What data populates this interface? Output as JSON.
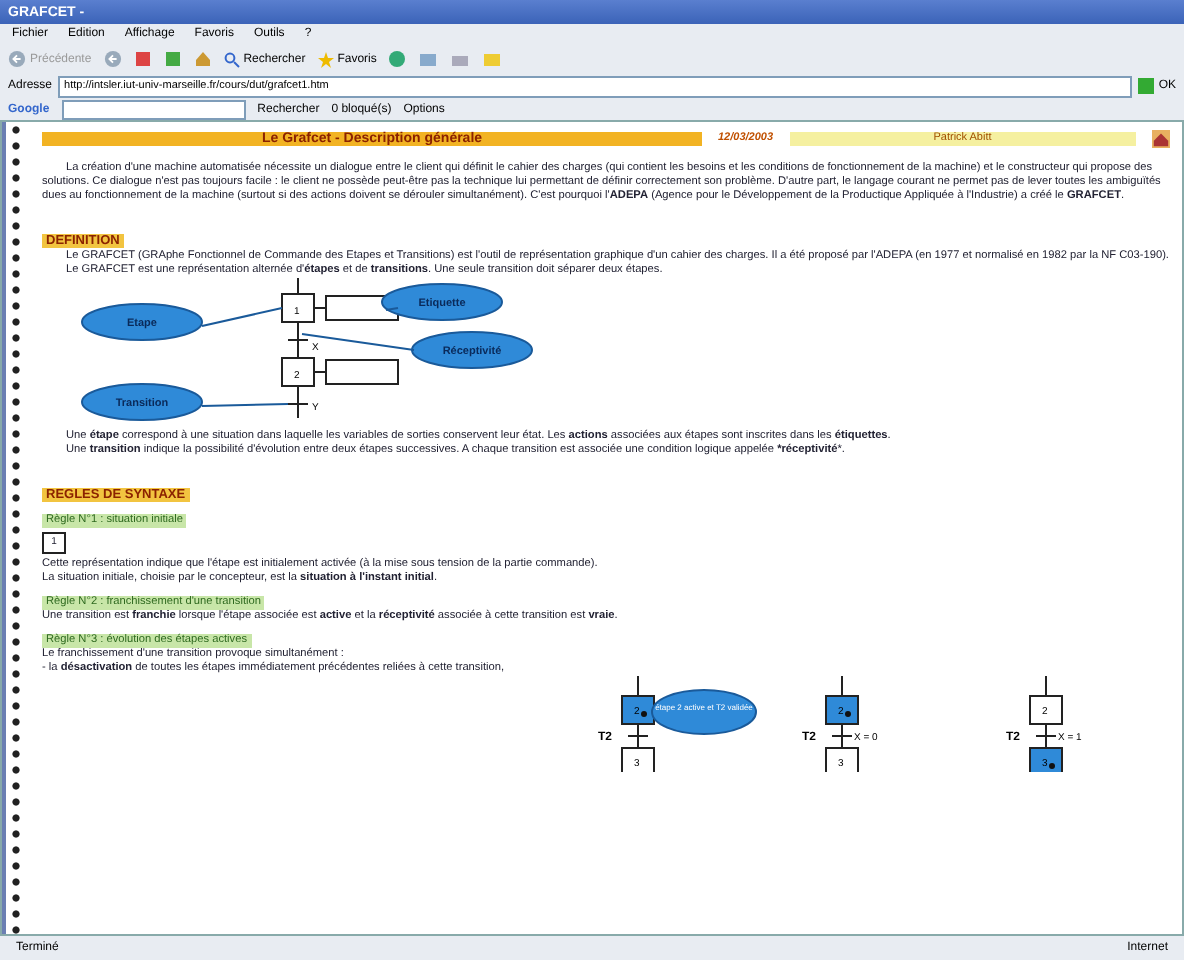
{
  "window": {
    "title": "GRAFCET -"
  },
  "menu": [
    "Fichier",
    "Edition",
    "Affichage",
    "Favoris",
    "Outils",
    "?"
  ],
  "toolbar": {
    "back": "Précédente",
    "search": "Rechercher",
    "favorites": "Favoris"
  },
  "address": {
    "label": "Adresse",
    "value": "http://intsler.iut-univ-marseille.fr/cours/dut/grafcet1.htm",
    "go": "OK"
  },
  "google_bar": {
    "logo": "Google",
    "search": "Rechercher",
    "blocked": "0 bloqué(s)",
    "options": "Options"
  },
  "page": {
    "title": "Le Grafcet - Description générale",
    "date": "12/03/2003",
    "author": "Patrick Abitt",
    "intro": "La création d'une machine automatisée nécessite un dialogue entre le client qui définit le cahier des charges (qui contient les besoins et les conditions de fonctionnement de la machine) et le constructeur qui propose des solutions. Ce dialogue n'est pas toujours facile : le client ne possède peut-être pas la technique lui permettant de définir correctement son problème. D'autre part, le langage courant ne permet pas de lever toutes les ambiguïtés dues au fonctionnement de la machine (surtout si des actions doivent se dérouler simultanément). C'est pourquoi l'**ADEPA** (Agence pour le Développement de la Productique Appliquée à l'Industrie) a créé le **GRAFCET**.",
    "definition": {
      "heading": "DEFINITION",
      "paragraphs": [
        "Le GRAFCET (GRAphe Fonctionnel de Commande des Etapes et Transitions) est l'outil de représentation graphique d'un cahier des charges. Il a été proposé par l'ADEPA (en 1977 et normalisé en 1982 par la NF C03-190).",
        "Le GRAFCET est une représentation alternée d'**étapes** et de **transitions**. Une seule transition doit séparer deux étapes."
      ],
      "diagram": {
        "bubbles": [
          "Etape",
          "Etiquette",
          "Réceptivité",
          "Transition"
        ],
        "steps": [
          "1",
          "2"
        ],
        "conditions": [
          "X",
          "Y"
        ]
      },
      "after": [
        "Une **étape** correspond à une situation dans laquelle les variables de sorties conservent leur état. Les **actions** associées aux étapes sont inscrites dans les **étiquettes**.",
        "Une **transition** indique la possibilité d'évolution entre deux étapes successives. A chaque transition est associée une condition logique appelée ***réceptivité***."
      ]
    },
    "rules": {
      "heading": "REGLES DE SYNTAXE",
      "items": [
        {
          "label": "Règle N°1 : situation initiale",
          "initial_step": "1",
          "lines": [
            "Cette représentation indique que l'étape est initialement activée (à la mise sous tension de la partie commande).",
            "La situation initiale, choisie par le concepteur, est la **situation à l'instant initial**."
          ]
        },
        {
          "label": "Règle N°2 : franchissement d'une transition",
          "lines": [
            "Une transition est **franchie** lorsque l'étape associée est **active** et la **réceptivité** associée à cette transition est **vraie**."
          ]
        },
        {
          "label": "Règle N°3 : évolution des étapes actives",
          "lines": [
            "Le franchissement d'une transition provoque simultanément :",
            "- la **désactivation** de toutes les étapes immédiatement précédentes reliées à cette transition,"
          ]
        }
      ],
      "examples": [
        {
          "transition": "T2",
          "upper": {
            "number": "2",
            "active": true
          },
          "lower": {
            "number": "3",
            "active": false
          },
          "note": "étape 2 active et T2 validée"
        },
        {
          "transition": "T2",
          "condition": "X = 0",
          "upper": {
            "number": "2",
            "active": true
          },
          "lower": {
            "number": "3",
            "active": false
          }
        },
        {
          "transition": "T2",
          "condition": "X = 1",
          "upper": {
            "number": "2",
            "active": false
          },
          "lower": {
            "number": "3",
            "active": true
          }
        }
      ]
    }
  },
  "status_bar": {
    "left": "Terminé",
    "right": "Internet"
  }
}
